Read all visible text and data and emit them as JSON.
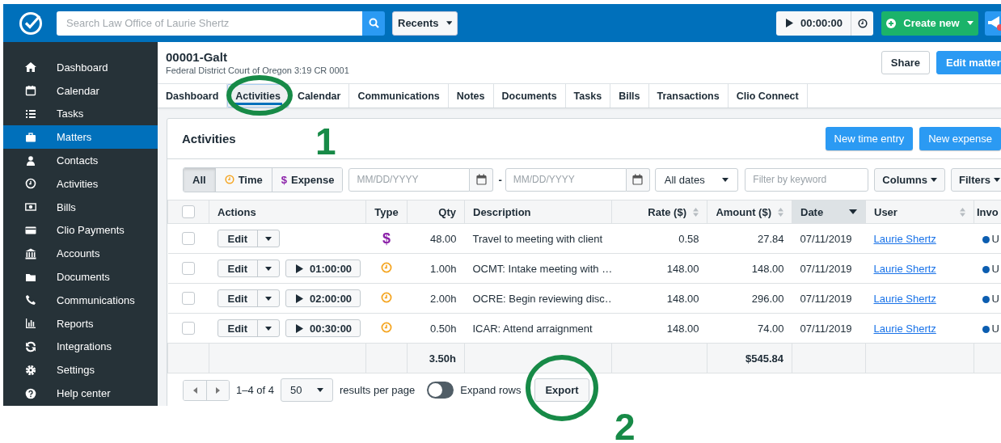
{
  "header": {
    "search": {
      "placeholder": "Search Law Office of Laurie Shertz"
    },
    "recents": "Recents",
    "timer": "00:00:00",
    "create_new": "Create new"
  },
  "sidebar": {
    "items": [
      {
        "label": "Dashboard",
        "selected": false
      },
      {
        "label": "Calendar",
        "selected": false
      },
      {
        "label": "Tasks",
        "selected": false
      },
      {
        "label": "Matters",
        "selected": true
      },
      {
        "label": "Contacts",
        "selected": false
      },
      {
        "label": "Activities",
        "selected": false
      },
      {
        "label": "Bills",
        "selected": false
      },
      {
        "label": "Clio Payments",
        "selected": false
      },
      {
        "label": "Accounts",
        "selected": false
      },
      {
        "label": "Documents",
        "selected": false
      },
      {
        "label": "Communications",
        "selected": false
      },
      {
        "label": "Reports",
        "selected": false
      },
      {
        "label": "Integrations",
        "selected": false
      },
      {
        "label": "Settings",
        "selected": false
      },
      {
        "label": "Help center",
        "selected": false
      }
    ]
  },
  "matter": {
    "title": "00001-Galt",
    "subtitle": "Federal District Court of Oregon 3:19 CR 0001",
    "buttons": [
      "Share",
      "Edit matter"
    ]
  },
  "tabs": [
    {
      "label": "Dashboard",
      "selected": false
    },
    {
      "label": "Activities",
      "selected": true
    },
    {
      "label": "Calendar",
      "selected": false
    },
    {
      "label": "Communications",
      "selected": false
    },
    {
      "label": "Notes",
      "selected": false
    },
    {
      "label": "Documents",
      "selected": false
    },
    {
      "label": "Tasks",
      "selected": false
    },
    {
      "label": "Bills",
      "selected": false
    },
    {
      "label": "Transactions",
      "selected": false
    },
    {
      "label": "Clio Connect",
      "selected": false
    }
  ],
  "activities": {
    "title": "Activities",
    "buttons": [
      "New time entry",
      "New expense"
    ],
    "filters": {
      "segments": [
        {
          "label": "All",
          "kind": "all",
          "selected": true
        },
        {
          "label": "Time",
          "kind": "time",
          "selected": false
        },
        {
          "label": "Expense",
          "kind": "expense",
          "symbol": "$",
          "selected": false
        }
      ],
      "date_from": {
        "placeholder": "MM/DD/YYYY"
      },
      "separator": "-",
      "date_to": {
        "placeholder": "MM/DD/YYYY"
      },
      "date_range": "All dates",
      "keyword": {
        "placeholder": "Filter by keyword"
      },
      "columns_button": "Columns",
      "filters_button": "Filters"
    },
    "table": {
      "select_all_checked": false,
      "columns": [
        {
          "label": "Actions",
          "sortable": false,
          "sorted": false
        },
        {
          "label": "Type",
          "sortable": false,
          "sorted": false
        },
        {
          "label": "Qty",
          "sortable": false,
          "sorted": false
        },
        {
          "label": "Description",
          "sortable": false,
          "sorted": false
        },
        {
          "label": "Rate ($)",
          "sortable": true,
          "sorted": false
        },
        {
          "label": "Amount ($)",
          "sortable": true,
          "sorted": false
        },
        {
          "label": "Date",
          "sortable": true,
          "sorted": true
        },
        {
          "label": "User",
          "sortable": true,
          "sorted": false
        },
        {
          "label": "Invo"
        }
      ],
      "rows": [
        {
          "checked": false,
          "edit": "Edit",
          "kind": "expense",
          "symbol": "$",
          "qty": "48.00",
          "description": "Travel to meeting with client",
          "rate": "0.58",
          "amount": "27.84",
          "date": "07/11/2019",
          "user": "Laurie Shertz",
          "status": "U"
        },
        {
          "checked": false,
          "edit": "Edit",
          "timer": "01:00:00",
          "kind": "time",
          "qty": "1.00h",
          "description": "OCMT: Intake meeting with …",
          "rate": "148.00",
          "amount": "148.00",
          "date": "07/11/2019",
          "user": "Laurie Shertz",
          "status": "U"
        },
        {
          "checked": false,
          "edit": "Edit",
          "timer": "02:00:00",
          "kind": "time",
          "qty": "2.00h",
          "description": "OCRE: Begin reviewing disc…",
          "rate": "148.00",
          "amount": "296.00",
          "date": "07/11/2019",
          "user": "Laurie Shertz",
          "status": "U"
        },
        {
          "checked": false,
          "edit": "Edit",
          "timer": "00:30:00",
          "kind": "time",
          "qty": "0.50h",
          "description": "ICAR: Attend arraignment",
          "rate": "148.00",
          "amount": "74.00",
          "date": "07/11/2019",
          "user": "Laurie Shertz",
          "status": "U"
        }
      ],
      "totals": {
        "qty": "3.50h",
        "amount": "$545.84"
      }
    },
    "footer": {
      "range": "1–4 of 4",
      "per_page": "50",
      "per_page_label": "results per page",
      "expand": {
        "label": "Expand rows",
        "on": false
      },
      "export": "Export"
    }
  },
  "annotations": [
    {
      "label": "1"
    },
    {
      "label": "2"
    }
  ]
}
